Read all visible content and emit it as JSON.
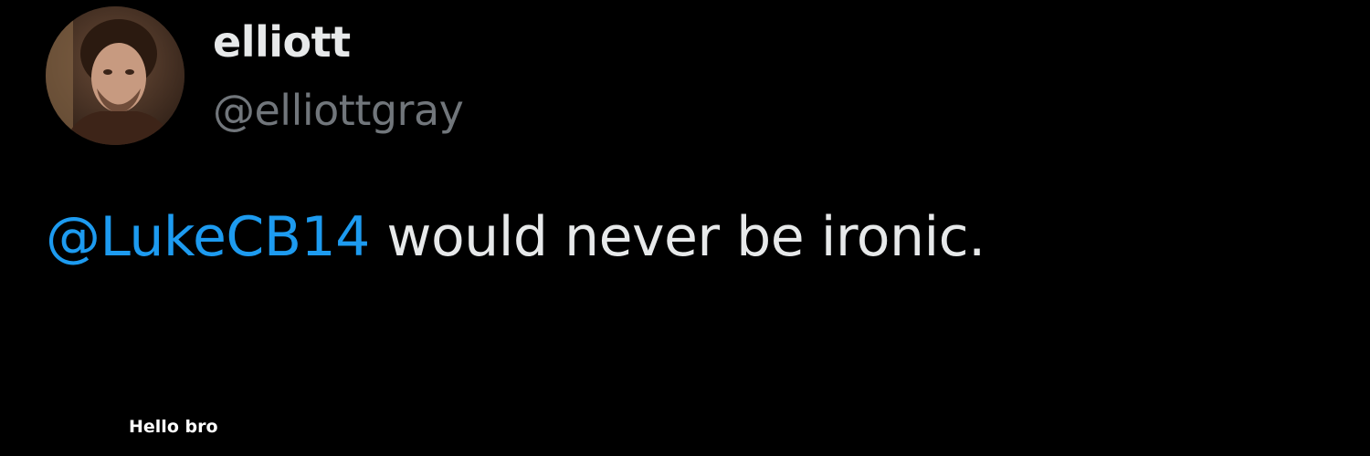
{
  "tweet": {
    "author": {
      "display_name": "elliott",
      "handle": "@elliottgray",
      "avatar_icon": "user-avatar-photo"
    },
    "body": {
      "mention": "@LukeCB14",
      "text": " would never be ironic."
    }
  },
  "caption": "Hello bro",
  "colors": {
    "background": "#000000",
    "primary_text": "#e7e9ea",
    "secondary_text": "#71767b",
    "mention": "#1d9bf0"
  }
}
